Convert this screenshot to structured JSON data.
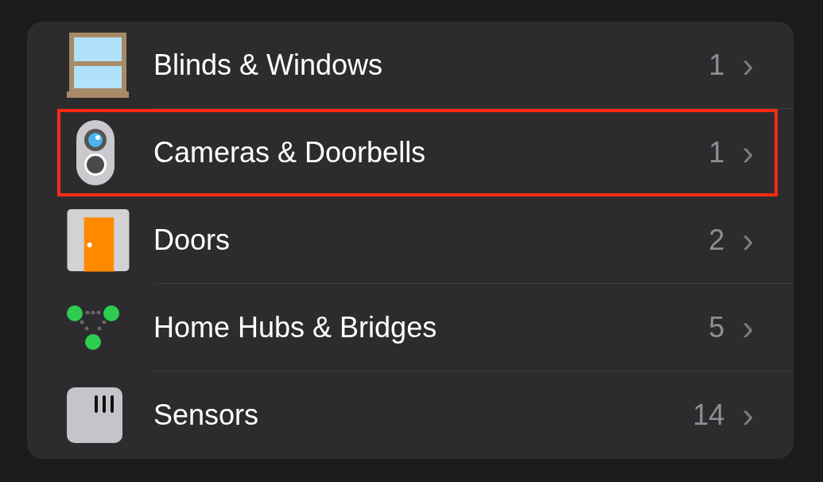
{
  "categories": [
    {
      "kind": "window",
      "label": "Blinds & Windows",
      "count": "1",
      "chevron": "›",
      "highlighted": false
    },
    {
      "kind": "camera",
      "label": "Cameras & Doorbells",
      "count": "1",
      "chevron": "›",
      "highlighted": true
    },
    {
      "kind": "door",
      "label": "Doors",
      "count": "2",
      "chevron": "›",
      "highlighted": false
    },
    {
      "kind": "hub",
      "label": "Home Hubs & Bridges",
      "count": "5",
      "chevron": "›",
      "highlighted": false
    },
    {
      "kind": "sensor",
      "label": "Sensors",
      "count": "14",
      "chevron": "›",
      "highlighted": false
    }
  ]
}
